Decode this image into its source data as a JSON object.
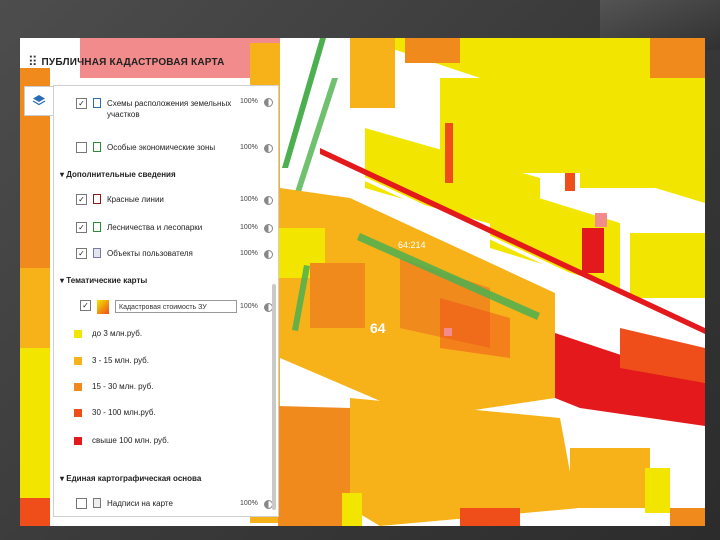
{
  "app": {
    "title": "ПУБЛИЧНАЯ КАДАСТРОВАЯ КАРТА",
    "logo_glyph": "⠿"
  },
  "layers_button_icon": "layers-icon",
  "panel": {
    "top_layers": [
      {
        "label": "Схемы расположения земельных участков",
        "checked": true,
        "pct": "100%",
        "color": "#2a6db5"
      },
      {
        "label": "Особые экономические зоны",
        "checked": false,
        "pct": "100%",
        "color": "#2e8b3a"
      }
    ],
    "section_additional": "Дополнительные сведения",
    "additional_layers": [
      {
        "label": "Красные линии",
        "checked": true,
        "pct": "100%",
        "color": "#8b1a1a"
      },
      {
        "label": "Лесничества и лесопарки",
        "checked": true,
        "pct": "100%",
        "color": "#2e8b3a"
      },
      {
        "label": "Объекты пользователя",
        "checked": true,
        "pct": "100%",
        "color": "#7a7aa0"
      }
    ],
    "section_thematic": "Тематические карты",
    "thematic": {
      "checked": true,
      "select_value": "Кадастровая стоимость ЗУ",
      "pct": "100%"
    },
    "legend": [
      {
        "label": "до 3 млн.руб.",
        "color": "#f2e600"
      },
      {
        "label": "3 - 15 млн. руб.",
        "color": "#f7b21a"
      },
      {
        "label": "15 - 30 млн. руб.",
        "color": "#f08a1c"
      },
      {
        "label": "30 - 100 млн.руб.",
        "color": "#ef4e1a"
      },
      {
        "label": "свыше 100 млн. руб.",
        "color": "#e3191c"
      }
    ],
    "section_base": "Единая картографическая основа",
    "base_layers": [
      {
        "label": "Надписи на карте",
        "checked": false,
        "pct": "100%"
      }
    ]
  },
  "map": {
    "quarter_label": "64",
    "parcel_label": "64:214",
    "colors": {
      "yellow": "#f2e600",
      "orange_light": "#f7b21a",
      "orange": "#f08a1c",
      "red_orange": "#ef4e1a",
      "red": "#e3191c",
      "green": "#4caf50",
      "pink": "#f28b8b"
    }
  }
}
